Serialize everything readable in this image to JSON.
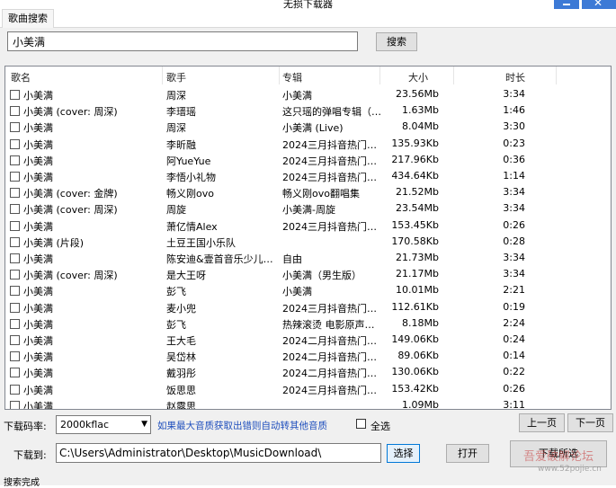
{
  "window": {
    "title": "无损下载器",
    "close_glyph": "✕"
  },
  "tab": {
    "label": "歌曲搜索"
  },
  "search": {
    "value": "小美满",
    "button": "搜索"
  },
  "table": {
    "headers": [
      "歌名",
      "歌手",
      "专辑",
      "大小",
      "时长"
    ],
    "rows": [
      {
        "name": "小美满",
        "artist": "周深",
        "album": "小美满",
        "size": "23.56Mb",
        "duration": "3:34"
      },
      {
        "name": "小美满 (cover: 周深)",
        "artist": "李瑨瑶",
        "album": "这只瑶的弹唱专辑（…",
        "size": "1.63Mb",
        "duration": "1:46"
      },
      {
        "name": "小美满",
        "artist": "周深",
        "album": "小美满 (Live)",
        "size": "8.04Mb",
        "duration": "3:30"
      },
      {
        "name": "小美满",
        "artist": "李昕融",
        "album": "2024三月抖音热门…",
        "size": "135.93Kb",
        "duration": "0:23"
      },
      {
        "name": "小美满",
        "artist": "阿YueYue",
        "album": "2024三月抖音热门…",
        "size": "217.96Kb",
        "duration": "0:36"
      },
      {
        "name": "小美满",
        "artist": "李悟小礼物",
        "album": "2024三月抖音热门…",
        "size": "434.64Kb",
        "duration": "1:14"
      },
      {
        "name": "小美满 (cover: 金牌)",
        "artist": "畅义刚ovo",
        "album": "畅义刚ovo翻唱集",
        "size": "21.52Mb",
        "duration": "3:34"
      },
      {
        "name": "小美满 (cover: 周深)",
        "artist": "周旋",
        "album": "小美满-周旋",
        "size": "23.54Mb",
        "duration": "3:34"
      },
      {
        "name": "小美满",
        "artist": "萧亿情Alex",
        "album": "2024三月抖音热门…",
        "size": "153.45Kb",
        "duration": "0:26"
      },
      {
        "name": "小美满 (片段)",
        "artist": "土豆王国小乐队",
        "album": "",
        "size": "170.58Kb",
        "duration": "0:28"
      },
      {
        "name": "小美满",
        "artist": "陈安迪&壹首音乐少儿…",
        "album": "自由",
        "size": "21.73Mb",
        "duration": "3:34"
      },
      {
        "name": "小美满 (cover: 周深)",
        "artist": "是大王呀",
        "album": "小美满（男生版）",
        "size": "21.17Mb",
        "duration": "3:34"
      },
      {
        "name": "小美满",
        "artist": "彭飞",
        "album": "小美满",
        "size": "10.01Mb",
        "duration": "2:21"
      },
      {
        "name": "小美满",
        "artist": "麦小兜",
        "album": "2024三月抖音热门…",
        "size": "112.61Kb",
        "duration": "0:19"
      },
      {
        "name": "小美满",
        "artist": "彭飞",
        "album": "热辣滚烫 电影原声…",
        "size": "8.18Mb",
        "duration": "2:24"
      },
      {
        "name": "小美满",
        "artist": "王大毛",
        "album": "2024二月抖音热门…",
        "size": "149.06Kb",
        "duration": "0:24"
      },
      {
        "name": "小美满",
        "artist": "吴岱林",
        "album": "2024二月抖音热门…",
        "size": "89.06Kb",
        "duration": "0:14"
      },
      {
        "name": "小美满",
        "artist": "戴羽彤",
        "album": "2024二月抖音热门…",
        "size": "130.06Kb",
        "duration": "0:22"
      },
      {
        "name": "小美满",
        "artist": "饭思思",
        "album": "2024三月抖音热门…",
        "size": "153.42Kb",
        "duration": "0:26"
      },
      {
        "name": "小美满",
        "artist": "赵露思",
        "album": "",
        "size": "1.09Mb",
        "duration": "3:11"
      }
    ]
  },
  "bitrate": {
    "label": "下载码率:",
    "value": "2000kflac"
  },
  "notice": "如果最大音质获取出错则自动转其他音质",
  "select_all": {
    "label": "全选"
  },
  "paging": {
    "prev": "上一页",
    "next": "下一页"
  },
  "download": {
    "label": "下载到:",
    "path": "C:\\Users\\Administrator\\Desktop\\MusicDownload\\",
    "choose": "选择",
    "open": "打开",
    "submit": "下载所选"
  },
  "status": "搜索完成",
  "watermark": {
    "line1": "吾爱破解论坛",
    "line2": "www.52pojie.cn"
  }
}
